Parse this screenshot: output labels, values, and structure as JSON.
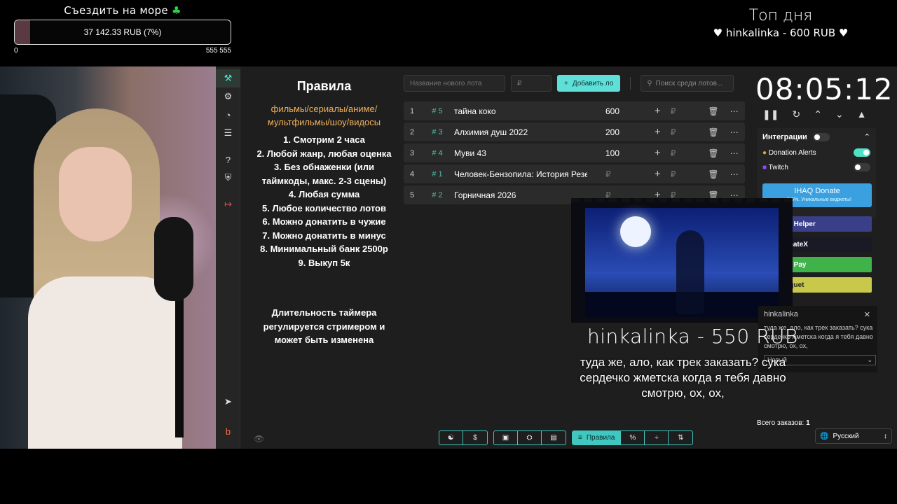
{
  "goal": {
    "title": "Съездить на море",
    "amount_text": "37 142.33 RUB (7%)",
    "progress_percent": 7,
    "min": "0",
    "max": "555 555",
    "fill_color": "#5a3a42"
  },
  "top_day": {
    "title": "Топ дня",
    "leader": "♥ hinkalinka - 600 RUB ♥"
  },
  "rules": {
    "title": "Правила",
    "subtitle": "фильмы/сериалы/аниме/ мультфильмы/шоу/видосы",
    "lines": [
      "1. Смотрим 2 часа",
      "2. Любой жанр, любая оценка",
      "3. Без обнаженки (или таймкоды, макс. 2-3 сцены)",
      "4. Любая сумма",
      "5. Любое количество лотов",
      "6. Можно донатить в чужие",
      "7. Можно донатить в минус",
      "8. Минимальный банк 2500р",
      "9. Выкуп 5к"
    ],
    "note": "Длительность таймера регулируется стримером и может быть изменена"
  },
  "lot_form": {
    "name_placeholder": "Название нового лота",
    "amount_placeholder": "₽",
    "add_label": "Добавить ло",
    "search_placeholder": "Поиск среди лотов..."
  },
  "lots": [
    {
      "n": "1",
      "id": "5",
      "name": "тайна коко",
      "amount": "600"
    },
    {
      "n": "2",
      "id": "3",
      "name": "Алхимия душ 2022",
      "amount": "200"
    },
    {
      "n": "3",
      "id": "4",
      "name": "Муви 43",
      "amount": "100"
    },
    {
      "n": "4",
      "id": "1",
      "name": "Человек-Бензопила: История Резе",
      "amount": "₽"
    },
    {
      "n": "5",
      "id": "2",
      "name": "Горничная 2026",
      "amount": "₽"
    }
  ],
  "timer": {
    "value": "08:05:12"
  },
  "integrations": {
    "title": "Интеграции",
    "services": [
      {
        "label": "Donation Alerts",
        "enabled": true
      },
      {
        "label": "Twitch",
        "enabled": false
      }
    ]
  },
  "promos": {
    "ihaq_title": "IHAQ Donate",
    "ihaq_sub": "~ 3.5%. Уникальные виджеты!",
    "buttons": [
      {
        "label": "Donate Helper",
        "color": "#3a3f8a"
      },
      {
        "label": "DonateX",
        "color": "#1a1a26"
      },
      {
        "label": "Donate Pay",
        "color": "#3fb34a"
      },
      {
        "label": "Tourniquet",
        "color": "#c8c84a"
      }
    ]
  },
  "chat": {
    "user": "hinkalinka",
    "text": "туда же, ало, как трек заказать? сука сердечко жметска когда я тебя давно смотрю, ох, ох,",
    "tag": "Новый"
  },
  "donation": {
    "name": "hinkalinka - 550 RUB",
    "message": "туда же, ало, как трек заказать? сука сердечко жметска когда я тебя давно смотрю, ох, ох,"
  },
  "footer": {
    "orders_label": "Всего заказов:",
    "orders_count": "1",
    "language": "Русский",
    "rules_button": "Правила"
  }
}
